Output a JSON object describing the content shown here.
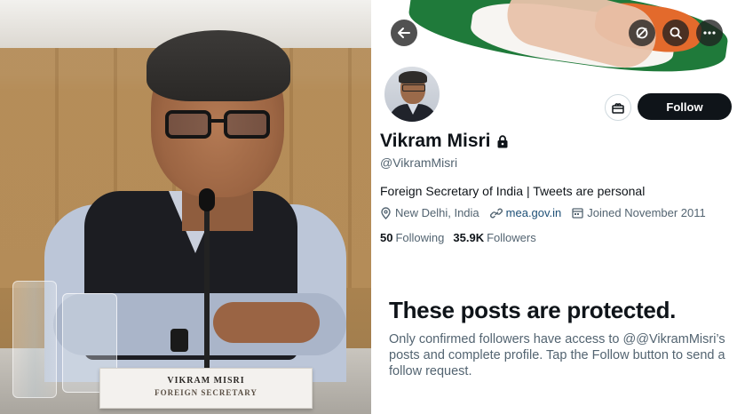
{
  "photo": {
    "nameplate_line1": "VIKRAM MISRI",
    "nameplate_line2": "FOREIGN SECRETARY"
  },
  "header": {
    "back_icon": "arrow-left-icon",
    "action_icons": [
      "blocked-refresh-icon",
      "search-icon",
      "more-icon"
    ]
  },
  "profile": {
    "display_name": "Vikram Misri",
    "protected_icon": "lock-icon",
    "handle": "@VikramMisri",
    "bio": "Foreign Secretary of India | Tweets are personal",
    "location": "New Delhi, India",
    "website": "mea.gov.in",
    "joined": "Joined November 2011",
    "following_count": "50",
    "following_label": "Following",
    "followers_count": "35.9K",
    "followers_label": "Followers",
    "follow_button": "Follow",
    "subscribe_icon": "gift-icon"
  },
  "protected_notice": {
    "title": "These posts are protected.",
    "body": "Only confirmed followers have access to @@VikramMisri’s posts and complete profile. Tap the Follow button to send a follow request."
  },
  "colors": {
    "text_primary": "#0f1419",
    "text_secondary": "#536471",
    "button_dark": "#0f1419",
    "link": "#1d4f76"
  }
}
